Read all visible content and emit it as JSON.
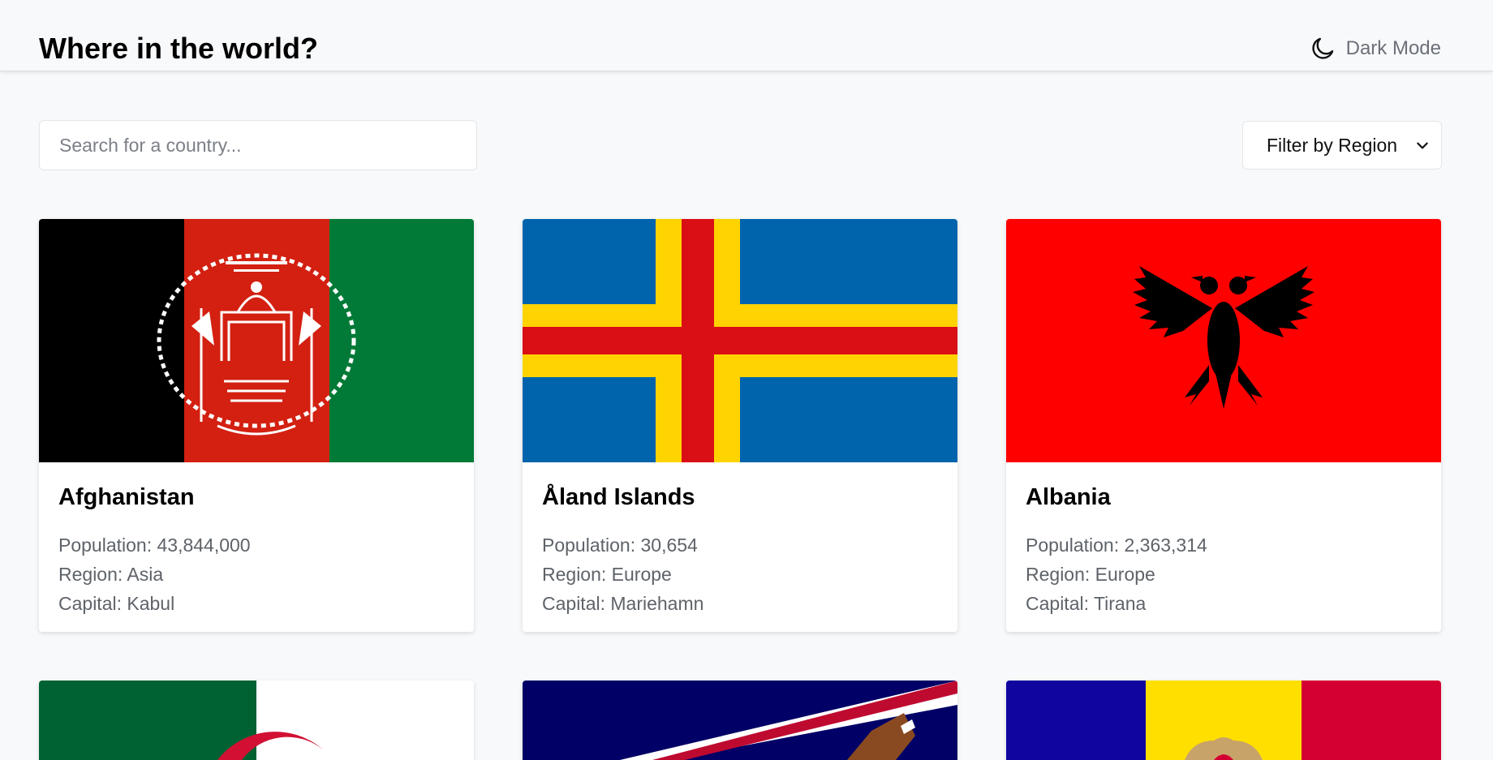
{
  "header": {
    "title": "Where in the world?",
    "dark_mode_label": "Dark Mode"
  },
  "search": {
    "placeholder": "Search for a country..."
  },
  "filter": {
    "label": "Filter by Region"
  },
  "countries": [
    {
      "name": "Afghanistan",
      "population": "Population: 43,844,000",
      "region": "Region: Asia",
      "capital": "Capital: Kabul"
    },
    {
      "name": "Åland Islands",
      "population": "Population: 30,654",
      "region": "Region: Europe",
      "capital": "Capital: Mariehamn"
    },
    {
      "name": "Albania",
      "population": "Population: 2,363,314",
      "region": "Region: Europe",
      "capital": "Capital: Tirana"
    }
  ],
  "colors": {
    "background": "#f8f9fa",
    "text_muted": "#5e6369",
    "afghanistan": [
      "#000000",
      "#d32011",
      "#007a36"
    ],
    "aland": {
      "blue": "#0064ad",
      "yellow": "#ffd300",
      "red": "#da0e15"
    },
    "albania": {
      "red": "#ff0000",
      "black": "#000000"
    },
    "algeria": {
      "green": "#006233",
      "white": "#ffffff",
      "red": "#d21034"
    },
    "american_samoa": {
      "navy": "#000066",
      "red": "#bf0a30",
      "white": "#ffffff",
      "brown": "#8a4a21"
    },
    "andorra": {
      "blue": "#10069f",
      "yellow": "#fedf00",
      "red": "#d50032"
    }
  }
}
